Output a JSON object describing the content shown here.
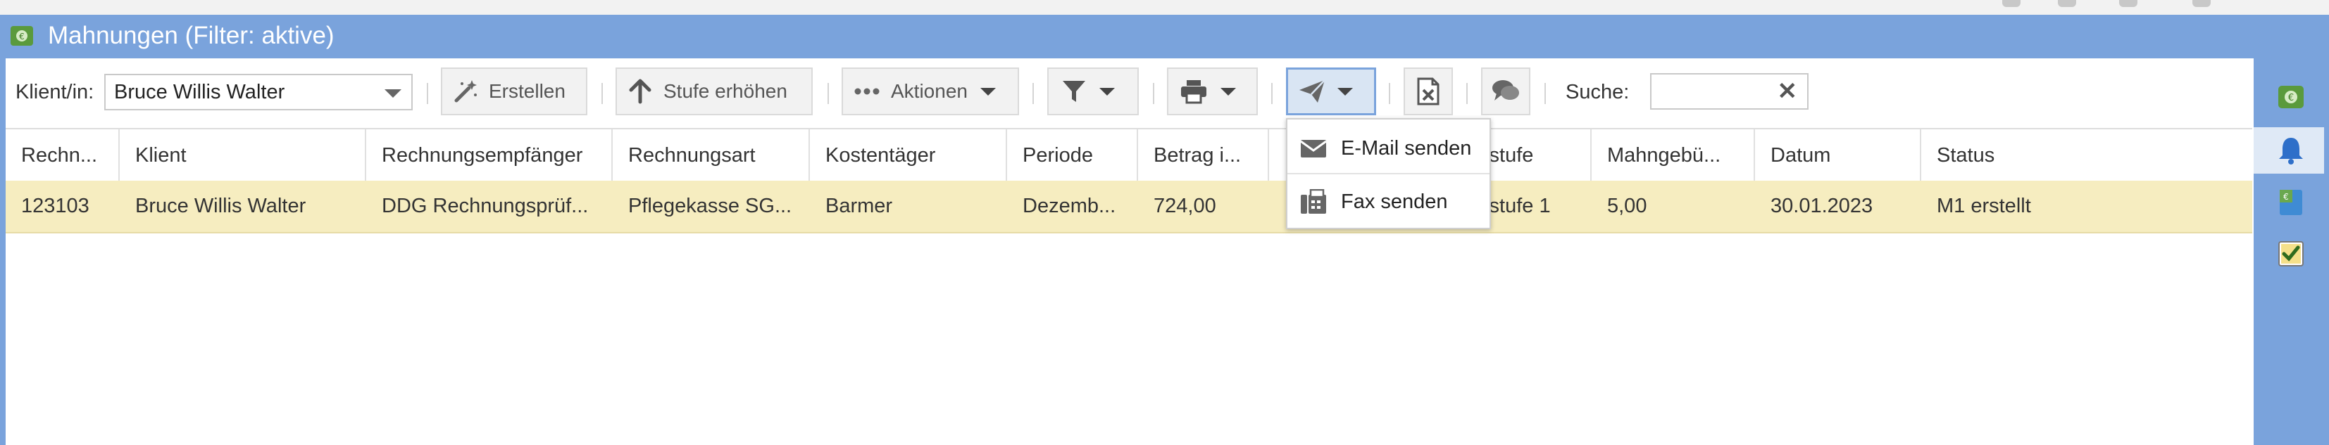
{
  "window": {
    "title": "Mahnungen (Filter: aktive)"
  },
  "toolbar": {
    "client_label": "Klient/in:",
    "client_value": "Bruce Willis Walter",
    "create_label": "Erstellen",
    "raise_level_label": "Stufe erhöhen",
    "actions_label": "Aktionen",
    "search_label": "Suche:",
    "search_value": ""
  },
  "table": {
    "columns": [
      "Rechn...",
      "Klient",
      "Rechnungsempfänger",
      "Rechnungsart",
      "Kostentäger",
      "Periode",
      "Betrag i...",
      "Mahnstufe",
      "Mahngebü...",
      "Datum",
      "Status"
    ],
    "rows": [
      [
        "123103",
        "Bruce Willis Walter",
        "DDG Rechnungsprüf...",
        "Pflegekasse SG...",
        "Barmer",
        "Dezemb...",
        "724,00",
        "Mahnstufe 1",
        "5,00",
        "30.01.2023",
        "M1 erstellt"
      ]
    ],
    "selected_row_color": "#f6edc0"
  },
  "send_menu": {
    "items": [
      {
        "label": "E-Mail senden",
        "icon": "envelope-icon"
      },
      {
        "label": "Fax senden",
        "icon": "fax-icon"
      }
    ]
  },
  "right_rail": {
    "items": [
      "money-icon",
      "bell-icon",
      "invoice-icon",
      "checkbox-icon"
    ],
    "active": "bell-icon"
  },
  "colors": {
    "accent": "#7aa3dc",
    "selected_row": "#f6edc0"
  }
}
